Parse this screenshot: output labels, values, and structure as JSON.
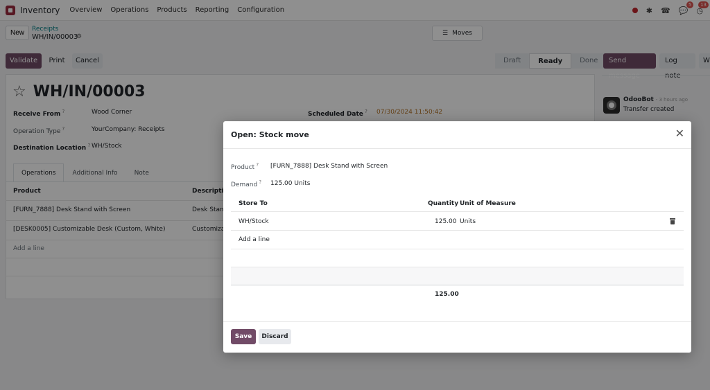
{
  "navbar": {
    "app_name": "Inventory",
    "menus": [
      "Overview",
      "Operations",
      "Products",
      "Reporting",
      "Configuration"
    ],
    "messages_badge": "5",
    "activity_badge": "13"
  },
  "breadcrumb": {
    "new_label": "New",
    "parent": "Receipts",
    "current": "WH/IN/00003",
    "moves_label": "Moves"
  },
  "actions": {
    "validate": "Validate",
    "print": "Print",
    "cancel": "Cancel"
  },
  "status": {
    "stages": [
      "Draft",
      "Ready",
      "Done"
    ],
    "active": "Ready"
  },
  "chatter": {
    "send_message": "Send message",
    "log_note": "Log note",
    "more": "W",
    "author": "OdooBot",
    "time": "- 3 hours ago",
    "message": "Transfer created"
  },
  "form": {
    "title": "WH/IN/00003",
    "receive_from_label": "Receive From",
    "receive_from_value": "Wood Corner",
    "operation_type_label": "Operation Type",
    "operation_type_value": "YourCompany: Receipts",
    "destination_label": "Destination Location",
    "destination_value": "WH/Stock",
    "scheduled_label": "Scheduled Date",
    "scheduled_value": "07/30/2024 11:50:42",
    "tabs": [
      "Operations",
      "Additional Info",
      "Note"
    ],
    "columns": [
      "Product",
      "Descriptio"
    ],
    "rows": [
      {
        "product": "[FURN_7888] Desk Stand with Screen",
        "desc": "Desk Stand"
      },
      {
        "product": "[DESK0005] Customizable Desk (Custom, White)",
        "desc": "Customiza"
      }
    ],
    "add_line": "Add a line"
  },
  "dialog": {
    "title": "Open: Stock move",
    "product_label": "Product",
    "product_value": "[FURN_7888] Desk Stand with Screen",
    "demand_label": "Demand",
    "demand_value": "125.00",
    "demand_unit": "Units",
    "columns": {
      "store_to": "Store To",
      "quantity": "Quantity",
      "uom": "Unit of Measure"
    },
    "line": {
      "store_to": "WH/Stock",
      "quantity": "125.00",
      "uom": "Units"
    },
    "add_line": "Add a line",
    "total": "125.00",
    "save": "Save",
    "discard": "Discard"
  },
  "colors": {
    "primary": "#714b67",
    "link": "#017e84"
  }
}
